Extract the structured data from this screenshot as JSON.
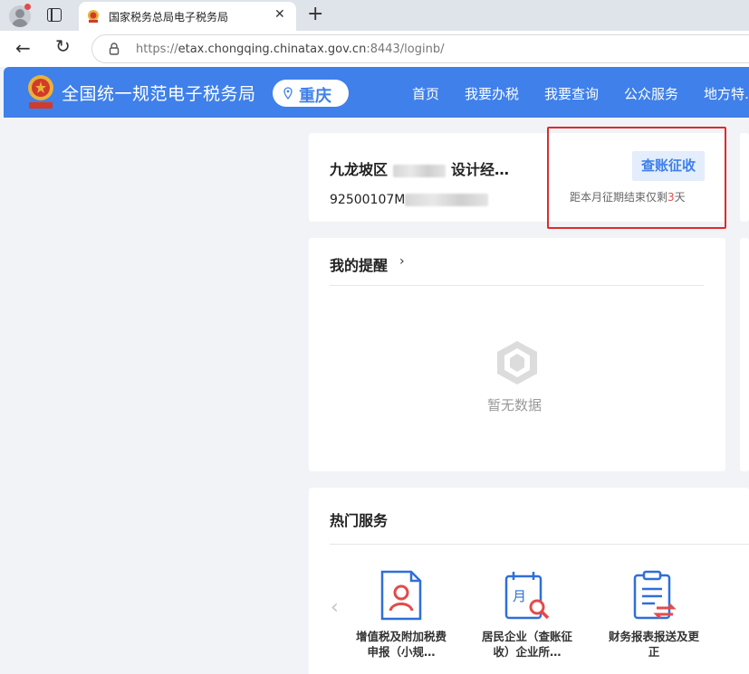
{
  "browser": {
    "tab_title": "国家税务总局电子税务局",
    "url_prefix": "https://",
    "url_host": "etax.chongqing.chinatax.gov.cn",
    "url_rest": ":8443/loginb/"
  },
  "header": {
    "site_title": "全国统一规范电子税务局",
    "city": "重庆",
    "nav": [
      "首页",
      "我要办税",
      "我要查询",
      "公众服务",
      "地方特…"
    ]
  },
  "company": {
    "name_start": "九龙坡区",
    "name_end": "设计经…",
    "id_start": "92500107M",
    "levy_button": "查账征收",
    "deadline_before": "距本月征期结束仅剩",
    "deadline_days": "3",
    "deadline_after": "天"
  },
  "reminders": {
    "title": "我的提醒",
    "chevron": "›",
    "empty_text": "暂无数据"
  },
  "hot_services": {
    "title": "热门服务",
    "items": [
      {
        "label": "增值税及附加税费申报（小规…",
        "icon": "person-document-icon"
      },
      {
        "label": "居民企业（查账征收）企业所…",
        "icon": "calendar-search-icon"
      },
      {
        "label": "财务报表报送及更正",
        "icon": "clipboard-exchange-icon"
      }
    ]
  },
  "colors": {
    "brand_blue": "#3f80ea",
    "highlight_red": "#e02a2a",
    "icon_blue": "#2f6fd8",
    "icon_red": "#e34b4b"
  }
}
